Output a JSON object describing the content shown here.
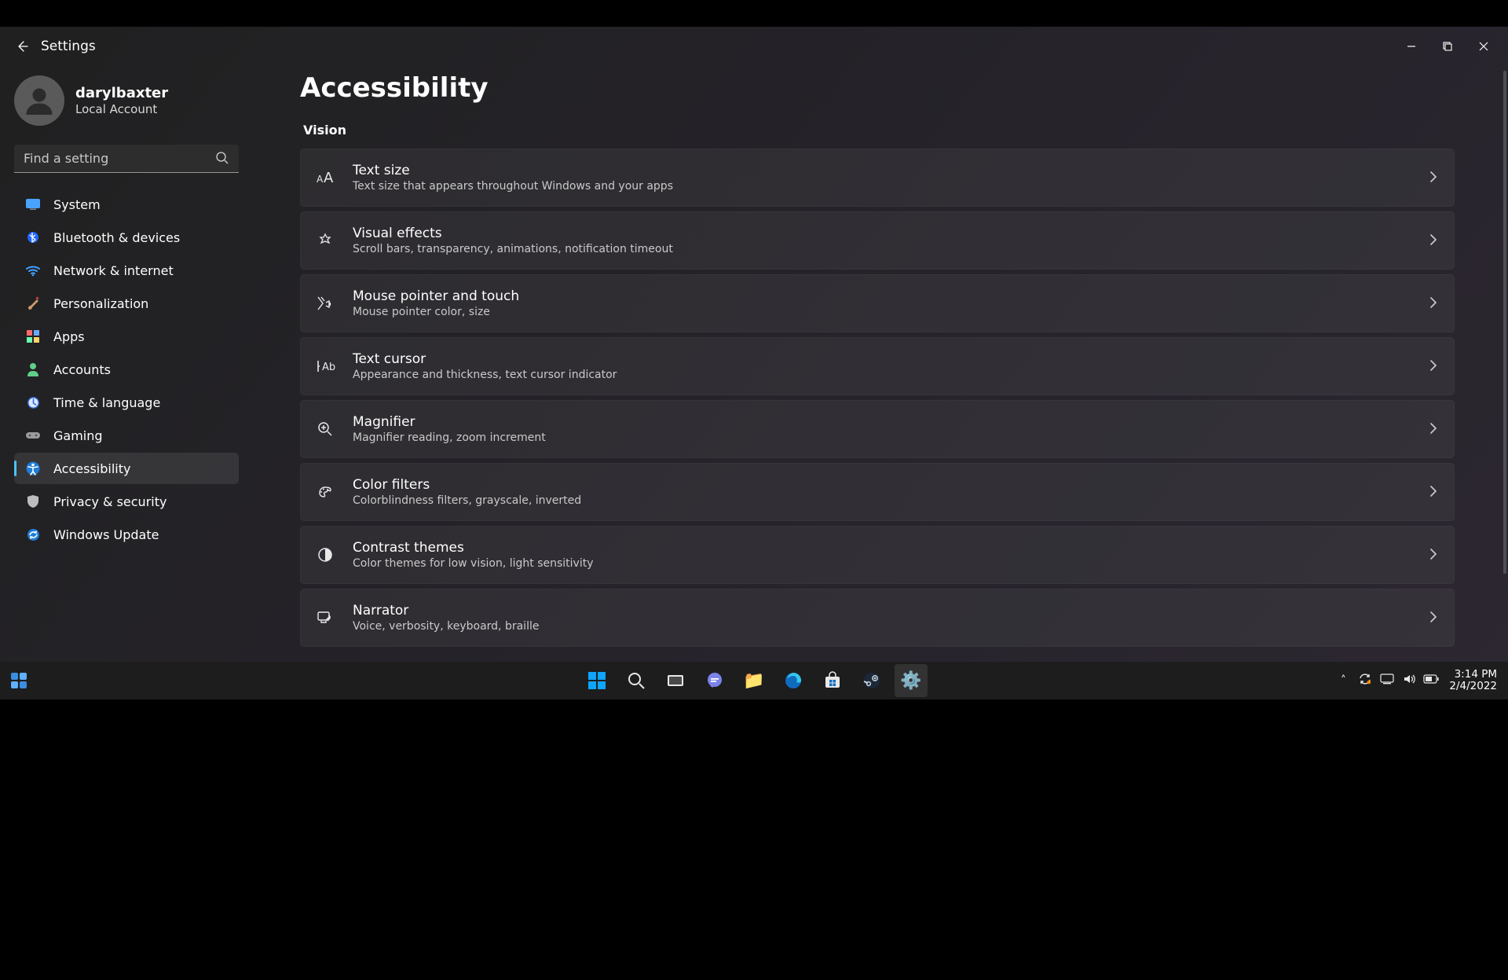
{
  "window": {
    "app_title": "Settings"
  },
  "account": {
    "name": "darylbaxter",
    "subtitle": "Local Account"
  },
  "search": {
    "placeholder": "Find a setting"
  },
  "sidebar": {
    "items": [
      {
        "label": "System",
        "icon": "🖥️"
      },
      {
        "label": "Bluetooth & devices",
        "icon": "bt"
      },
      {
        "label": "Network & internet",
        "icon": "📶"
      },
      {
        "label": "Personalization",
        "icon": "🖌️"
      },
      {
        "label": "Apps",
        "icon": "🔲"
      },
      {
        "label": "Accounts",
        "icon": "👤"
      },
      {
        "label": "Time & language",
        "icon": "🕒"
      },
      {
        "label": "Gaming",
        "icon": "🎮"
      },
      {
        "label": "Accessibility",
        "icon": "acc"
      },
      {
        "label": "Privacy & security",
        "icon": "🛡️"
      },
      {
        "label": "Windows Update",
        "icon": "🔄"
      }
    ],
    "active_index": 8
  },
  "page": {
    "title": "Accessibility",
    "section": "Vision",
    "items": [
      {
        "title": "Text size",
        "desc": "Text size that appears throughout Windows and your apps"
      },
      {
        "title": "Visual effects",
        "desc": "Scroll bars, transparency, animations, notification timeout"
      },
      {
        "title": "Mouse pointer and touch",
        "desc": "Mouse pointer color, size"
      },
      {
        "title": "Text cursor",
        "desc": "Appearance and thickness, text cursor indicator"
      },
      {
        "title": "Magnifier",
        "desc": "Magnifier reading, zoom increment"
      },
      {
        "title": "Color filters",
        "desc": "Colorblindness filters, grayscale, inverted"
      },
      {
        "title": "Contrast themes",
        "desc": "Color themes for low vision, light sensitivity"
      },
      {
        "title": "Narrator",
        "desc": "Voice, verbosity, keyboard, braille"
      }
    ]
  },
  "taskbar": {
    "time": "3:14 PM",
    "date": "2/4/2022"
  }
}
